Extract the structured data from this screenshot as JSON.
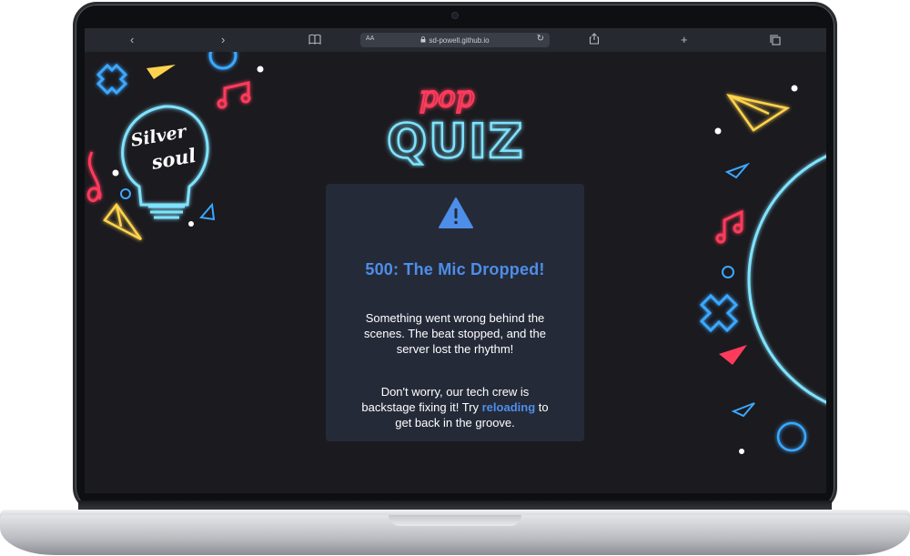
{
  "browser": {
    "back_icon": "‹",
    "forward_icon": "›",
    "reader_icon": "book-icon",
    "text_size_label": "AA",
    "url": "sd-powell.github.io",
    "share_icon": "share-icon",
    "new_tab_icon": "+",
    "tabs_icon": "tabs-icon"
  },
  "logo": {
    "brand_top": "Silver",
    "brand_bottom": "soul",
    "pop": "pop",
    "quiz": "QUIZ"
  },
  "error": {
    "title": "500: The Mic Dropped!",
    "paragraph1": "Something went wrong behind the scenes. The beat stopped, and the server lost the rhythm!",
    "paragraph2_before": "Don't worry, our tech crew is backstage fixing it! Try ",
    "reload_link": "reloading",
    "paragraph2_after": " to get back in the groove."
  },
  "colors": {
    "background": "#1b1a1f",
    "card": "#252a39",
    "accent_blue": "#4d8ee8",
    "neon_pink": "#ff3b5c",
    "neon_cyan": "#7fe3ff",
    "neon_yellow": "#ffd34d"
  }
}
